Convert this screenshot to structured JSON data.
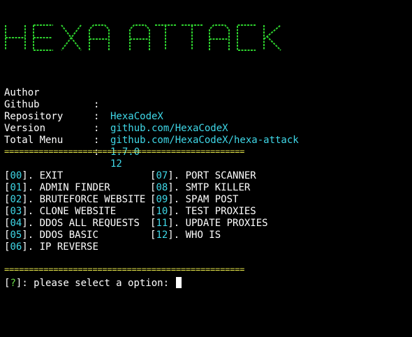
{
  "banner": {
    "title": "HEXA ATTACK",
    "color": "#2ed12e"
  },
  "info": [
    {
      "key": "Author",
      "sep": ":",
      "value": "HexaCodeX"
    },
    {
      "key": "Github",
      "sep": ":",
      "value": "github.com/HexaCodeX"
    },
    {
      "key": "Repository",
      "sep": ":",
      "value": "github.com/HexaCodeX/hexa-attack"
    },
    {
      "key": "Version",
      "sep": ":",
      "value": "1.7.0"
    },
    {
      "key": "Total Menu",
      "sep": ":",
      "value": "12"
    }
  ],
  "divider": "=================================================",
  "menu": [
    {
      "num": "00",
      "label": "EXIT"
    },
    {
      "num": "01",
      "label": "ADMIN FINDER"
    },
    {
      "num": "02",
      "label": "BRUTEFORCE WEBSITE"
    },
    {
      "num": "03",
      "label": "CLONE WEBSITE"
    },
    {
      "num": "04",
      "label": "DDOS ALL REQUESTS"
    },
    {
      "num": "05",
      "label": "DDOS BASIC"
    },
    {
      "num": "06",
      "label": "IP REVERSE"
    },
    {
      "num": "07",
      "label": "PORT SCANNER"
    },
    {
      "num": "08",
      "label": "SMTP KILLER"
    },
    {
      "num": "09",
      "label": "SPAM POST"
    },
    {
      "num": "10",
      "label": "TEST PROXIES"
    },
    {
      "num": "11",
      "label": "UPDATE PROXIES"
    },
    {
      "num": "12",
      "label": "WHO IS"
    }
  ],
  "prompt": {
    "open": "[",
    "mark": "?",
    "close": "]",
    "text": ": please select a option: "
  },
  "colors": {
    "background": "#000000",
    "foreground": "#ffffff",
    "cyan": "#3fd8e8",
    "yellow": "#e8e84a",
    "green": "#6de04a",
    "banner_green": "#2ed12e"
  }
}
